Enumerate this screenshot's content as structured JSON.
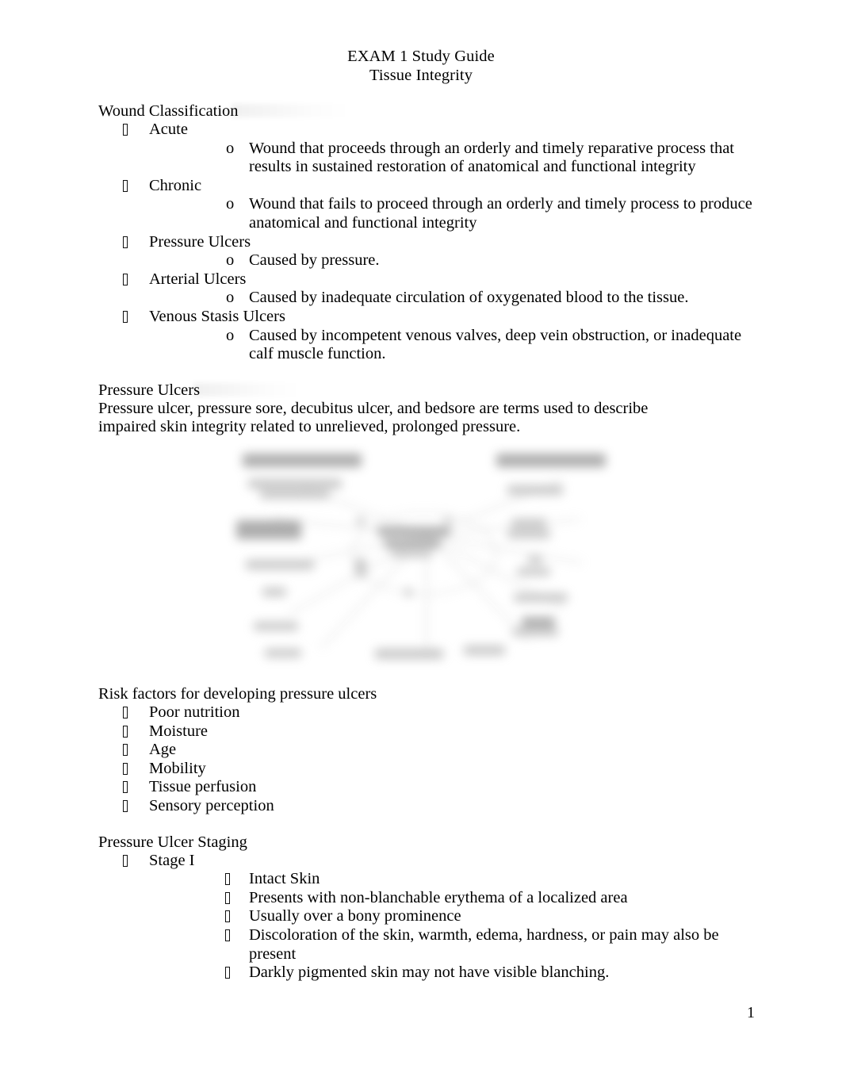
{
  "document": {
    "title_line_1": "EXAM 1 Study Guide",
    "title_line_2": "Tissue Integrity",
    "page_number": "1"
  },
  "markers": {
    "bullet_glyph": "missing-glyph-box",
    "sub_marker": "o"
  },
  "sections": {
    "wound_classification": {
      "heading": "Wound Classification",
      "items": [
        {
          "label": "Acute",
          "subitems": [
            "Wound that proceeds through an orderly and timely reparative process that results in sustained restoration of anatomical and functional integrity"
          ]
        },
        {
          "label": "Chronic",
          "subitems": [
            "Wound that fails to proceed through an orderly and timely process to produce anatomical and functional integrity"
          ]
        },
        {
          "label": "Pressure Ulcers",
          "subitems": [
            "Caused by pressure."
          ]
        },
        {
          "label": "Arterial Ulcers",
          "subitems": [
            "Caused by inadequate circulation of oxygenated blood to the tissue."
          ]
        },
        {
          "label": "Venous Stasis Ulcers",
          "subitems": [
            "Caused by incompetent venous valves, deep vein obstruction, or inadequate calf muscle function."
          ]
        }
      ]
    },
    "pressure_ulcers": {
      "heading": "Pressure Ulcers",
      "paragraph": "Pressure ulcer, pressure sore, decubitus ulcer, and bedsore are terms used to describe impaired skin integrity related to unrelieved, prolonged pressure."
    },
    "figure": {
      "description": "blurred concept map diagram (text illegible)"
    },
    "risk_factors": {
      "heading": "Risk factors for developing pressure ulcers",
      "items": [
        "Poor nutrition",
        "Moisture",
        "Age",
        "Mobility",
        "Tissue perfusion",
        "Sensory perception"
      ]
    },
    "staging": {
      "heading": "Pressure Ulcer Staging",
      "stages": [
        {
          "label": "Stage I",
          "points": [
            "Intact Skin",
            "Presents with non-blanchable erythema of a localized area",
            "Usually over a bony prominence",
            "Discoloration of the skin, warmth, edema, hardness, or pain may also be present",
            "Darkly pigmented skin may not have visible blanching."
          ]
        }
      ]
    }
  }
}
